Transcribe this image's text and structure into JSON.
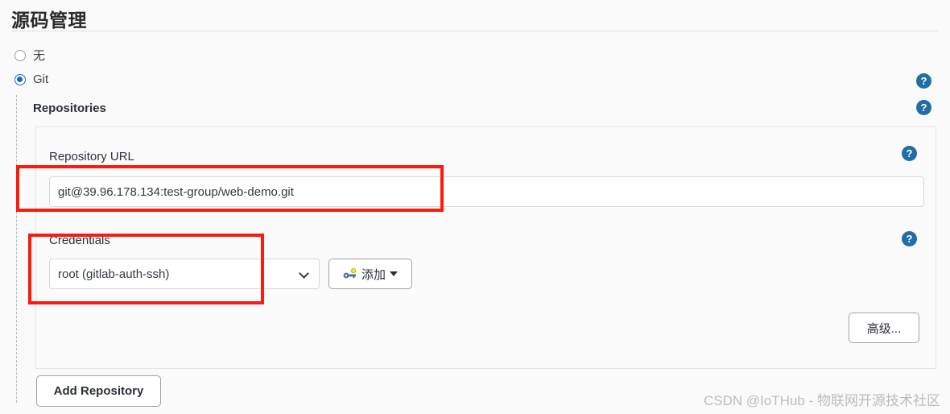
{
  "page": {
    "title": "源码管理"
  },
  "scm_options": [
    {
      "label": "无",
      "selected": false,
      "name": "scm-none"
    },
    {
      "label": "Git",
      "selected": true,
      "name": "scm-git"
    }
  ],
  "repositories": {
    "section_label": "Repositories",
    "repository_url": {
      "label": "Repository URL",
      "value": "git@39.96.178.134:test-group/web-demo.git",
      "placeholder": ""
    },
    "credentials": {
      "label": "Credentials",
      "selected": "root (gitlab-auth-ssh)",
      "options": [
        "root (gitlab-auth-ssh)"
      ],
      "add_button": "添加"
    },
    "advanced_button": "高级...",
    "add_repository_button": "Add Repository"
  },
  "help_icons": {
    "glyph": "?",
    "items": [
      {
        "name": "help-icon-git"
      },
      {
        "name": "help-icon-repositories"
      },
      {
        "name": "help-icon-repository-url"
      },
      {
        "name": "help-icon-credentials"
      }
    ]
  },
  "annotations": {
    "color": "#fc1a0e",
    "boxes": [
      "repository-url-highlight",
      "credentials-highlight"
    ]
  },
  "watermark": "CSDN @IoTHub - 物联网开源技术社区",
  "colors": {
    "accent_blue": "#1b64da",
    "help_blue": "#1f6fa5",
    "annotation_red": "#fc1a0e",
    "page_bg": "#fafafa"
  }
}
